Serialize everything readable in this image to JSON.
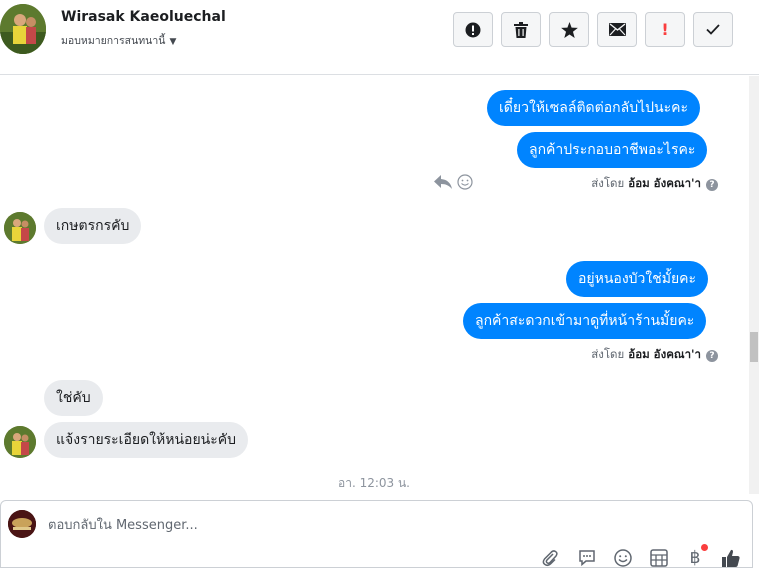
{
  "header": {
    "contact_name": "Wirasak Kaeoluechal",
    "assign_label": "มอบหมายการสนทนานี้",
    "actions": [
      "report",
      "delete",
      "star",
      "mark-unread",
      "important",
      "done"
    ],
    "important_glyph": "!"
  },
  "messages": [
    {
      "dir": "out",
      "text": "เดี๋ยวให้เซลล์ติดต่อกลับไปนะคะ"
    },
    {
      "dir": "out",
      "text": "ลูกค้าประกอบอาชีพอะไรคะ"
    },
    {
      "dir": "in",
      "text": "เกษตรกรคับ"
    },
    {
      "dir": "out",
      "text": "อยู่หนองบัวใช่มั้ยคะ"
    },
    {
      "dir": "out",
      "text": "ลูกค้าสะดวกเข้ามาดูที่หน้าร้านมั้ยคะ"
    },
    {
      "dir": "in",
      "text": "ใช่คับ"
    },
    {
      "dir": "in",
      "text": "แจ้งรายระเอียดให้หน่อยน่ะคับ"
    }
  ],
  "sent_by": {
    "prefix": "ส่งโดย",
    "name": "อ้อม อังคณา'า",
    "help": "?"
  },
  "timestamp": "อา. 12:03 น.",
  "composer": {
    "placeholder": "ตอบกลับใน Messenger...",
    "tools": [
      "attach-icon",
      "gif-icon",
      "emoji-icon",
      "template-icon",
      "baht-icon",
      "like-icon"
    ],
    "baht_glyph": "฿"
  },
  "colors": {
    "outgoing": "#0084ff",
    "incoming": "#e9ebee",
    "important": "#fa3e3e"
  }
}
